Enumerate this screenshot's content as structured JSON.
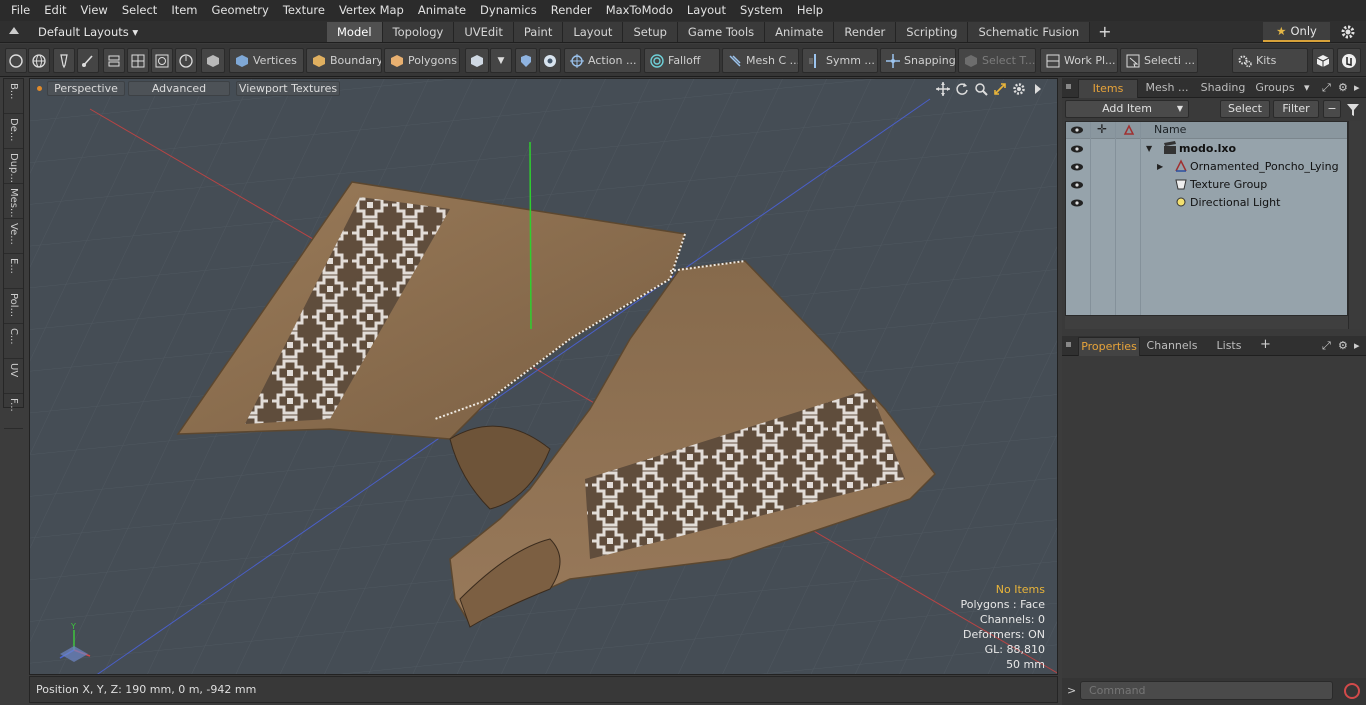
{
  "menu": [
    "File",
    "Edit",
    "View",
    "Select",
    "Item",
    "Geometry",
    "Texture",
    "Vertex Map",
    "Animate",
    "Dynamics",
    "Render",
    "MaxToModo",
    "Layout",
    "System",
    "Help"
  ],
  "layout_selector": "Default Layouts ▾",
  "tabs": [
    {
      "label": "Model",
      "active": true
    },
    {
      "label": "Topology",
      "active": false
    },
    {
      "label": "UVEdit",
      "active": false
    },
    {
      "label": "Paint",
      "active": false
    },
    {
      "label": "Layout",
      "active": false
    },
    {
      "label": "Setup",
      "active": false
    },
    {
      "label": "Game Tools",
      "active": false
    },
    {
      "label": "Animate",
      "active": false
    },
    {
      "label": "Render",
      "active": false
    },
    {
      "label": "Scripting",
      "active": false
    },
    {
      "label": "Schematic Fusion",
      "active": false
    }
  ],
  "only_button": "Only",
  "toolbar": {
    "vertices": "Vertices",
    "boundary": "Boundary",
    "polygons": "Polygons",
    "action": "Action ...",
    "falloff": "Falloff",
    "mesh_c": "Mesh C ...",
    "symm": "Symm ...",
    "snapping": "Snapping",
    "select_t": "Select T...",
    "work_pl": "Work Pl...",
    "selecti": "Selecti ...",
    "kits": "Kits"
  },
  "left_tabs": [
    "B...",
    "De...",
    "Dup...",
    "Mes...",
    "Ve...",
    "E...",
    "Pol...",
    "C...",
    "UV",
    "F..."
  ],
  "viewport": {
    "perspective": "Perspective",
    "advanced": "Advanced",
    "viewport_textures": "Viewport Textures",
    "info": {
      "no_items": "No Items",
      "polygons": "Polygons : Face",
      "channels": "Channels: 0",
      "deformers": "Deformers: ON",
      "gl": "GL: 88,810",
      "size": "50 mm"
    },
    "colors": {
      "background": "#454d55",
      "cloth": "#8d6f4f",
      "pattern_band": "#5c4a3a",
      "pattern": "#e4e0dc"
    }
  },
  "status": {
    "position": "Position X, Y, Z:   190 mm, 0 m, -942 mm"
  },
  "items_panel": {
    "tabs": [
      "Items",
      "Mesh ...",
      "Shading",
      "Groups"
    ],
    "add_item": "Add Item",
    "select": "Select",
    "filter": "Filter",
    "name_header": "Name",
    "tree": [
      {
        "label": "modo.lxo",
        "bold": true
      },
      {
        "label": "Ornamented_Poncho_Lying",
        "bold": false
      },
      {
        "label": "Texture Group",
        "bold": false
      },
      {
        "label": "Directional Light",
        "bold": false
      }
    ]
  },
  "props_panel": {
    "tabs": [
      "Properties",
      "Channels",
      "Lists"
    ]
  },
  "command": {
    "placeholder": "Command"
  }
}
